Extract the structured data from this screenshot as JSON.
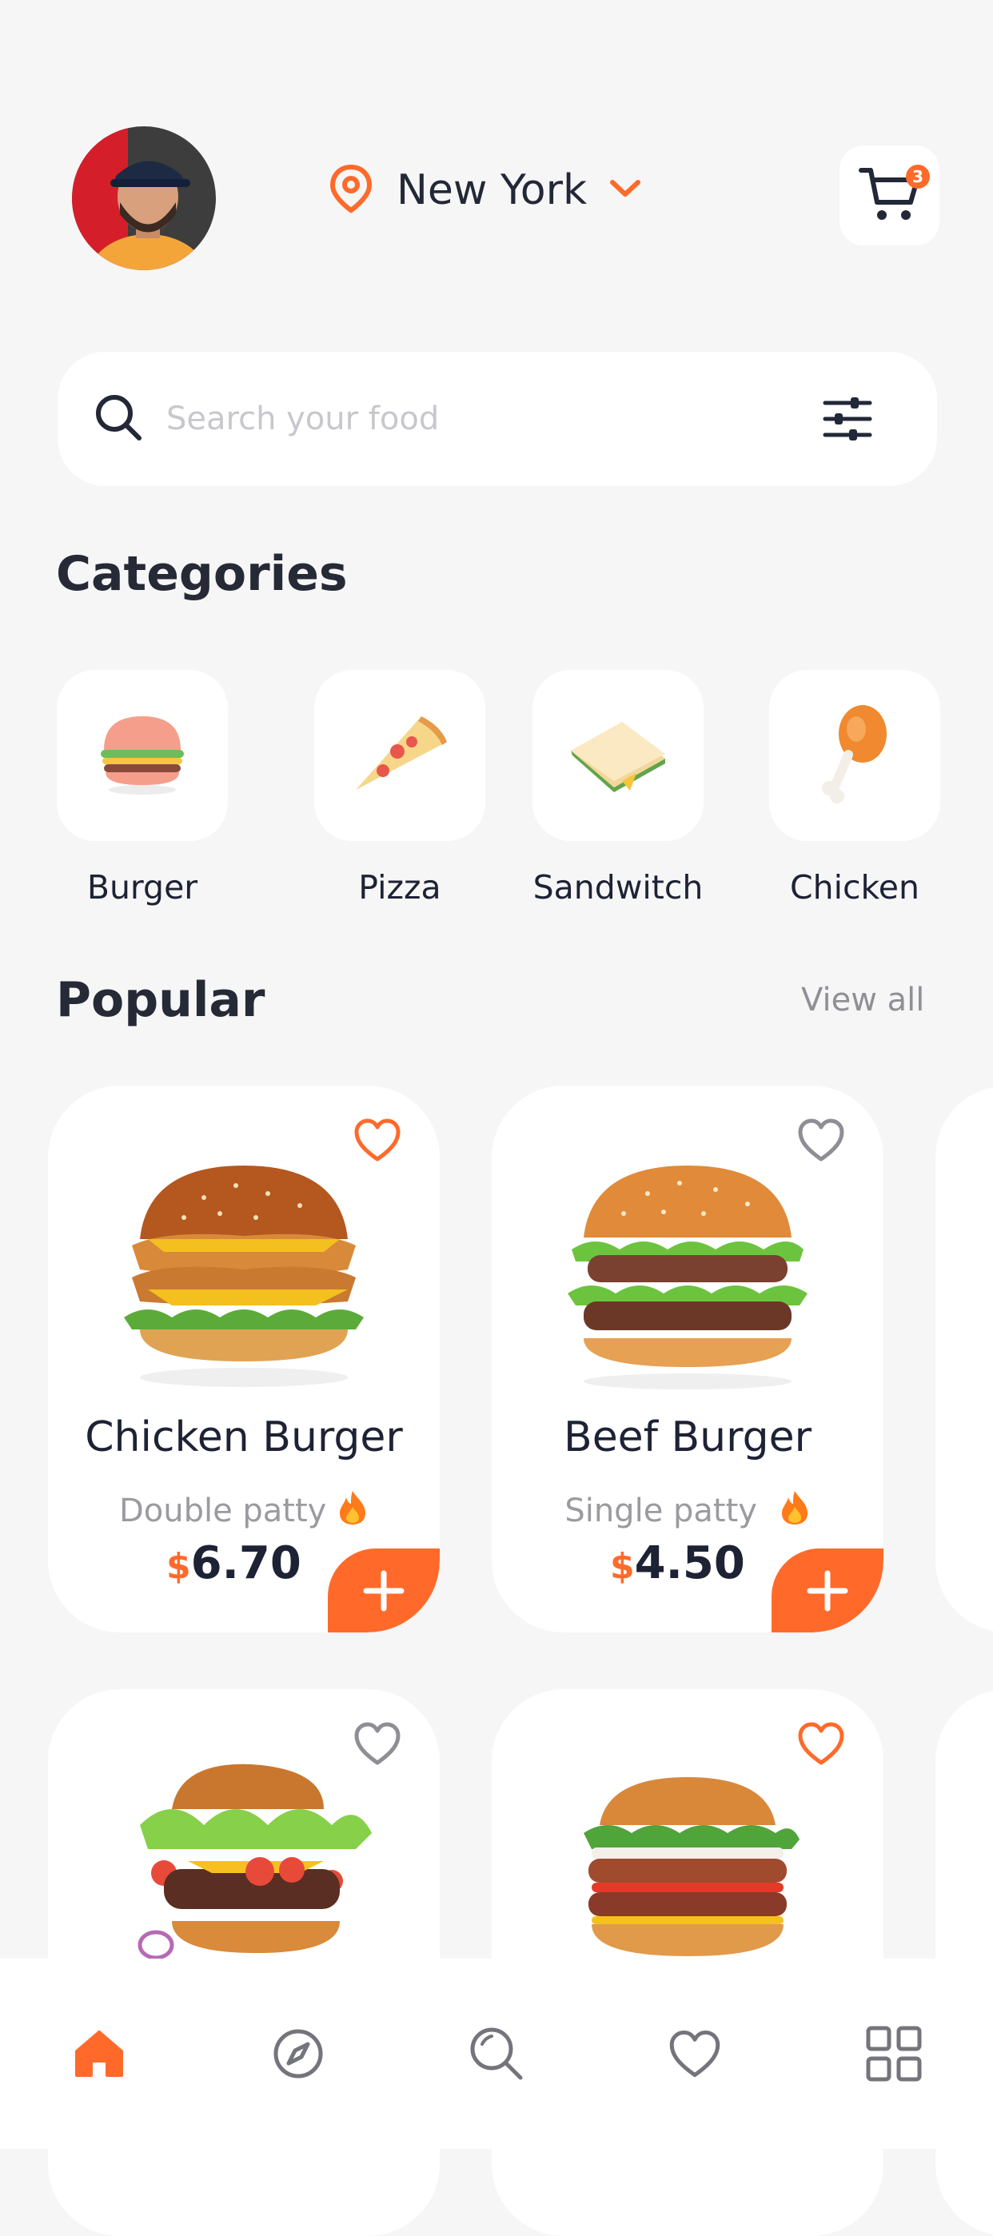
{
  "header": {
    "city": "New York",
    "cart_count": "3",
    "accent": "#ff6a2b"
  },
  "search": {
    "placeholder": "Search your food"
  },
  "categories": {
    "title": "Categories",
    "items": [
      {
        "label": "Burger",
        "icon": "burger-icon"
      },
      {
        "label": "Pizza",
        "icon": "pizza-icon"
      },
      {
        "label": "Sandwitch",
        "icon": "sandwich-icon"
      },
      {
        "label": "Chicken",
        "icon": "chicken-leg-icon"
      }
    ]
  },
  "popular": {
    "title": "Popular",
    "view_all": "View all",
    "items": [
      {
        "name": "Chicken Burger",
        "sub": "Double patty",
        "currency": "$",
        "price": "6.70",
        "favorited": true
      },
      {
        "name": "Beef Burger",
        "sub": "Single patty",
        "currency": "$",
        "price": "4.50",
        "favorited": false
      },
      {
        "favorited": false
      },
      {
        "favorited": true
      }
    ]
  },
  "nav": {
    "items": [
      "home-icon",
      "explore-icon",
      "search-icon",
      "favorites-icon",
      "menu-grid-icon"
    ],
    "active": "home-icon"
  }
}
